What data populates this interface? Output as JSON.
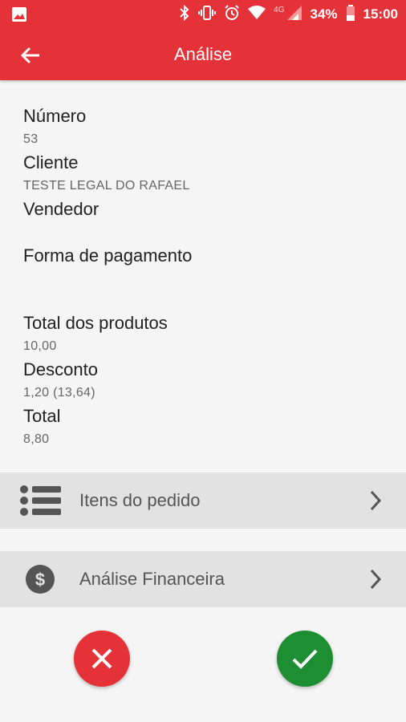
{
  "status_bar": {
    "battery": "34%",
    "time": "15:00",
    "network": "4G"
  },
  "app_bar": {
    "title": "Análise"
  },
  "order": {
    "numero_label": "Número",
    "numero_value": "53",
    "cliente_label": "Cliente",
    "cliente_value": "TESTE LEGAL DO RAFAEL",
    "vendedor_label": "Vendedor",
    "vendedor_value": "",
    "forma_pagamento_label": "Forma de pagamento",
    "forma_pagamento_value": "",
    "total_produtos_label": "Total dos produtos",
    "total_produtos_value": "10,00",
    "desconto_label": "Desconto",
    "desconto_value": "1,20 (13,64)",
    "total_label": "Total",
    "total_value": "8,80"
  },
  "nav_rows": [
    {
      "label": "Itens do pedido",
      "icon": "list-icon"
    },
    {
      "label": "Análise Financeira",
      "icon": "dollar-icon"
    }
  ],
  "colors": {
    "primary": "#e53238",
    "success": "#1e8e32",
    "row_bg": "#e2e2e2"
  }
}
